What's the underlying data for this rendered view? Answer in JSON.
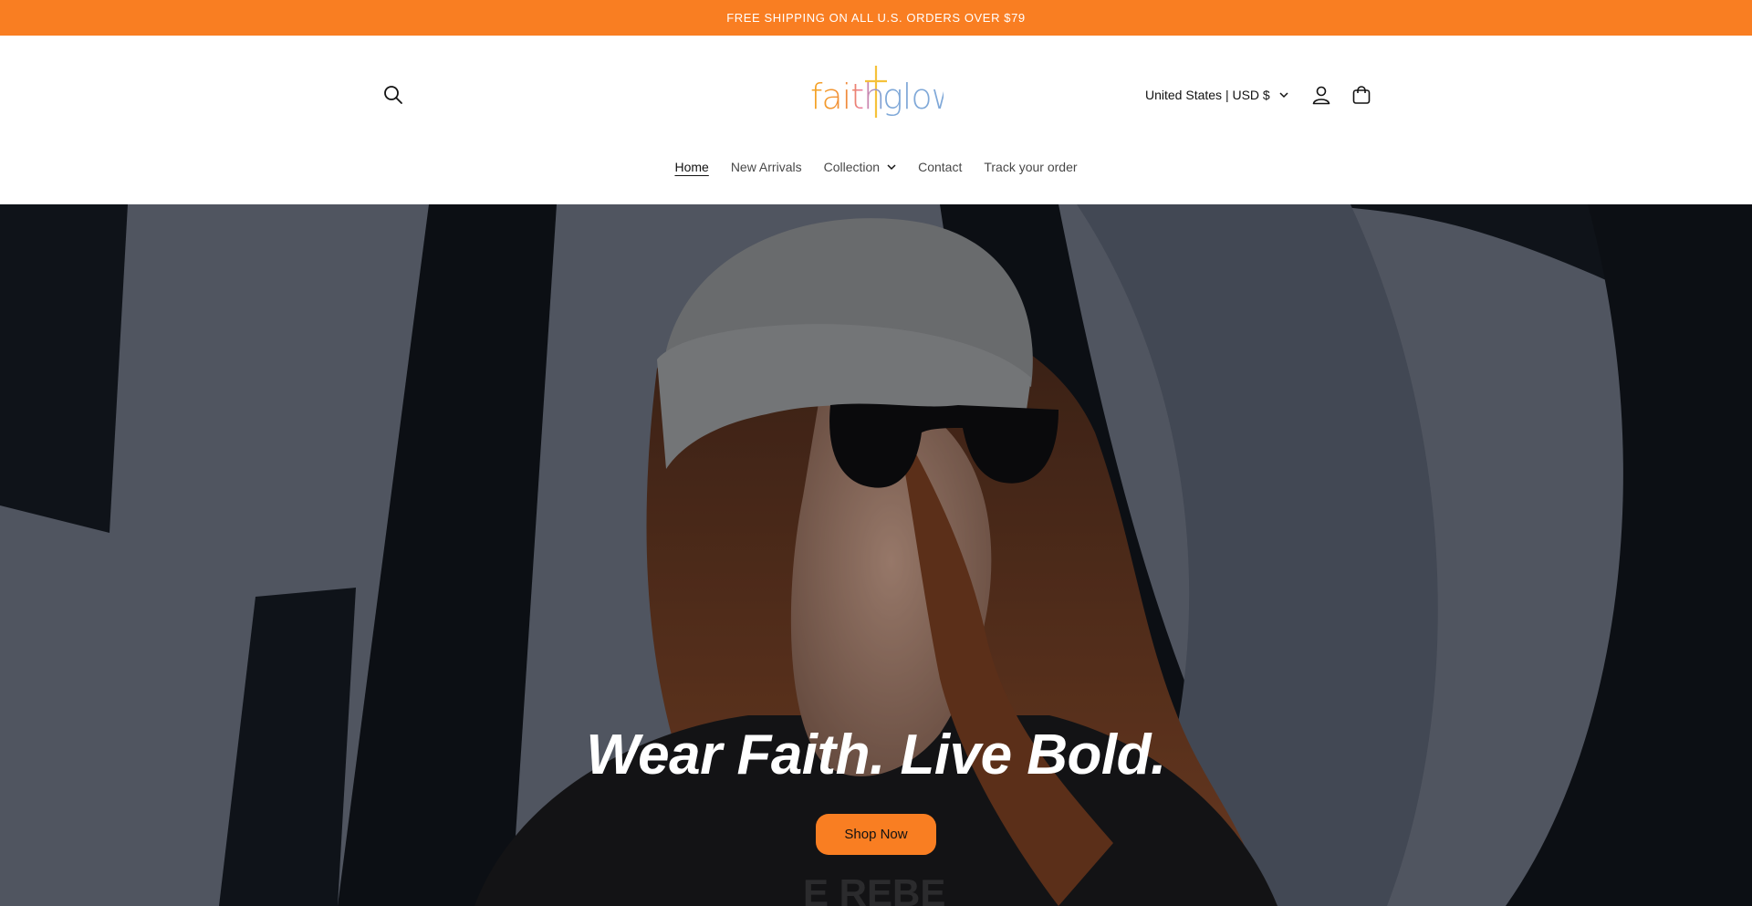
{
  "announcement": {
    "text": "FREE SHIPPING ON ALL U.S. ORDERS OVER $79"
  },
  "header": {
    "logo_text": "faithglow",
    "country_selector": "United States | USD $"
  },
  "nav": {
    "items": [
      {
        "label": "Home",
        "active": true
      },
      {
        "label": "New Arrivals",
        "active": false
      },
      {
        "label": "Collection",
        "active": false,
        "dropdown": true
      },
      {
        "label": "Contact",
        "active": false
      },
      {
        "label": "Track your order",
        "active": false
      }
    ]
  },
  "hero": {
    "headline": "Wear Faith. Live Bold.",
    "cta_label": "Shop Now"
  },
  "colors": {
    "brand_orange": "#f97e22",
    "hero_background": "#5e6572"
  },
  "icons": {
    "search": "search-icon",
    "account": "account-icon",
    "cart": "cart-icon",
    "chevron": "chevron-down-icon"
  }
}
